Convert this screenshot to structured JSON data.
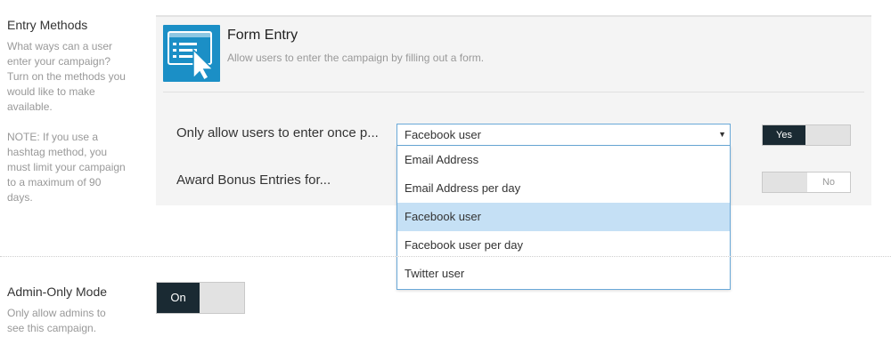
{
  "entry_methods": {
    "title": "Entry Methods",
    "description": "What ways can a user enter your campaign? Turn on the methods you would like to make available.",
    "note": "NOTE: If you use a hashtag method, you must limit your campaign to a maximum of 90 days."
  },
  "form_entry": {
    "title": "Form Entry",
    "description": "Allow users to enter the campaign by filling out a form.",
    "icon": "form-cursor-icon",
    "icon_color": "#1b8fc6"
  },
  "once_option": {
    "label": "Only allow users to enter once p...",
    "selected": "Facebook user",
    "toggle_label": "Yes",
    "toggle_on": true
  },
  "bonus_option": {
    "label": "Award Bonus Entries for...",
    "toggle_label": "No",
    "toggle_on": false
  },
  "dropdown_options": [
    "Email Address",
    "Email Address per day",
    "Facebook user",
    "Facebook user per day",
    "Twitter user"
  ],
  "admin_mode": {
    "title": "Admin-Only Mode",
    "description": "Only allow admins to see this campaign.",
    "toggle_label": "On",
    "toggle_on": true
  },
  "colors": {
    "toggle_dark": "#1a2a33",
    "select_border": "#6aa9d8",
    "selected_option_bg": "#c5e0f5"
  }
}
